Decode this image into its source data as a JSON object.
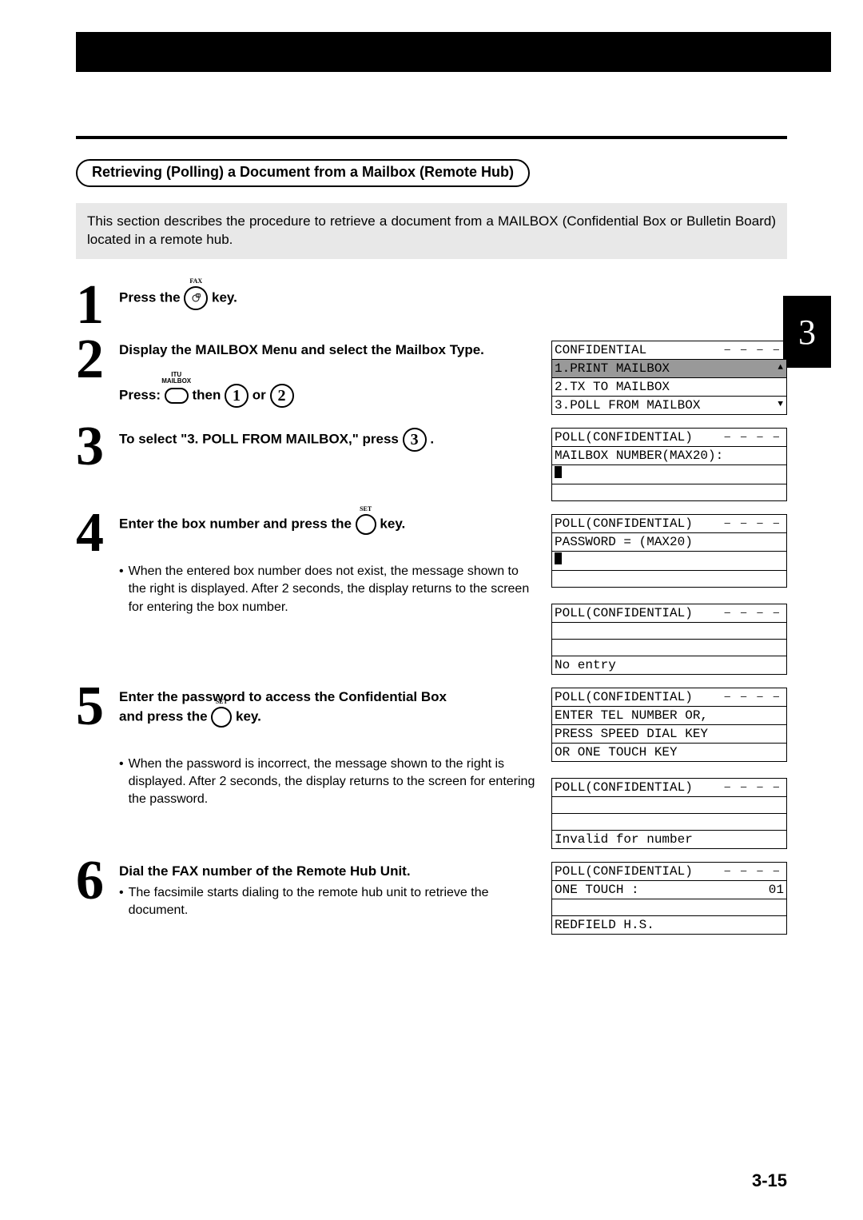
{
  "chapter_tab": "3",
  "page_number": "3-15",
  "section_title": "Retrieving (Polling) a Document from a Mailbox (Remote Hub)",
  "intro": "This section describes the procedure to retrieve a document from a MAILBOX (Confidential Box or Bulletin Board) located in a remote hub.",
  "key_labels": {
    "fax": "FAX",
    "itu_mailbox_top": "ITU",
    "itu_mailbox_bottom": "MAILBOX",
    "set": "SET"
  },
  "steps": [
    {
      "num": "1",
      "text_before": "Press the ",
      "key": "fax",
      "text_after": " key."
    },
    {
      "num": "2",
      "heading": "Display the MAILBOX Menu and select the Mailbox Type.",
      "press_line": {
        "prefix": "Press: ",
        "mid": " then ",
        "or": " or "
      },
      "circle_a": "1",
      "circle_b": "2",
      "lcd": [
        {
          "text": "CONFIDENTIAL",
          "dashed": true
        },
        {
          "text": "1.PRINT MAILBOX",
          "sel": true,
          "tri": "▲"
        },
        {
          "text": "2.TX TO MAILBOX"
        },
        {
          "text": "3.POLL FROM MAILBOX",
          "tri": "▼"
        }
      ]
    },
    {
      "num": "3",
      "text_before": "To select \"3. POLL FROM MAILBOX,\" press ",
      "circle": "3",
      "period": ".",
      "lcd": [
        {
          "text": "POLL(CONFIDENTIAL)",
          "dashed": true
        },
        {
          "text": "MAILBOX NUMBER(MAX20):"
        },
        {
          "text": "",
          "cursor": true
        },
        {
          "text": ""
        }
      ]
    },
    {
      "num": "4",
      "text_before": "Enter the box number and press the ",
      "key": "set",
      "text_after": " key.",
      "lcd": [
        {
          "text": "POLL(CONFIDENTIAL)",
          "dashed": true
        },
        {
          "text": "PASSWORD = (MAX20)"
        },
        {
          "text": "",
          "cursor": true
        },
        {
          "text": ""
        }
      ],
      "note": "When the entered box number does not exist, the message shown to the right is displayed.  After 2 seconds, the display returns to the screen for entering the box number.",
      "lcd2": [
        {
          "text": "POLL(CONFIDENTIAL)",
          "dashed": true
        },
        {
          "text": ""
        },
        {
          "text": ""
        },
        {
          "text": "No entry"
        }
      ]
    },
    {
      "num": "5",
      "line1": "Enter the password to access the Confidential Box",
      "line2_before": "and press the ",
      "key": "set",
      "line2_after": " key.",
      "lcd": [
        {
          "text": "POLL(CONFIDENTIAL)",
          "dashed": true
        },
        {
          "text": "ENTER TEL NUMBER OR,"
        },
        {
          "text": "PRESS SPEED DIAL KEY"
        },
        {
          "text": "OR ONE TOUCH KEY"
        }
      ],
      "note": "When the password is incorrect, the message shown to the right is displayed. After 2 seconds, the display returns to the screen for entering the password.",
      "lcd2": [
        {
          "text": "POLL(CONFIDENTIAL)",
          "dashed": true
        },
        {
          "text": ""
        },
        {
          "text": ""
        },
        {
          "text": "Invalid for number"
        }
      ]
    },
    {
      "num": "6",
      "heading": "Dial the FAX number of the Remote Hub Unit.",
      "note": "The facsimile starts dialing to the remote hub unit to retrieve the document.",
      "lcd": [
        {
          "text": "POLL(CONFIDENTIAL)",
          "dashed": true
        },
        {
          "text": "ONE TOUCH :",
          "right": "01"
        },
        {
          "text": ""
        },
        {
          "text": "REDFIELD H.S."
        }
      ]
    }
  ]
}
